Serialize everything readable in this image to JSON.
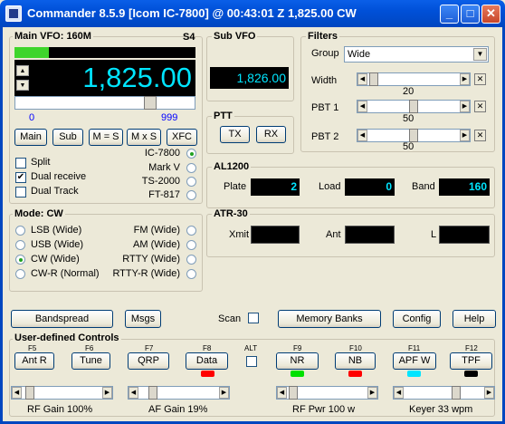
{
  "window": {
    "title": "Commander 8.5.9 [Icom IC-7800] @ 00:43:01 Z  1,825.00 CW"
  },
  "main_vfo": {
    "title": "Main VFO: 160M",
    "s_meter": "S4",
    "frequency": "1,825.00",
    "slider_min": "0",
    "slider_max": "999",
    "buttons": [
      "Main",
      "Sub",
      "M = S",
      "M x S",
      "XFC"
    ],
    "checks": [
      {
        "label": "Split",
        "checked": false
      },
      {
        "label": "Dual receive",
        "checked": true
      },
      {
        "label": "Dual Track",
        "checked": false
      }
    ],
    "radios": [
      {
        "label": "IC-7800",
        "on": true
      },
      {
        "label": "Mark V",
        "on": false
      },
      {
        "label": "TS-2000",
        "on": false
      },
      {
        "label": "FT-817",
        "on": false
      }
    ]
  },
  "sub_vfo": {
    "title": "Sub VFO",
    "frequency": "1,826.00"
  },
  "ptt": {
    "title": "PTT",
    "tx": "TX",
    "rx": "RX"
  },
  "filters": {
    "title": "Filters",
    "group_label": "Group",
    "group_value": "Wide",
    "rows": [
      {
        "label": "Width",
        "value": "20"
      },
      {
        "label": "PBT 1",
        "value": "50"
      },
      {
        "label": "PBT 2",
        "value": "50"
      }
    ]
  },
  "mode": {
    "title": "Mode: CW",
    "left": [
      {
        "label": "LSB (Wide)",
        "on": false
      },
      {
        "label": "USB (Wide)",
        "on": false
      },
      {
        "label": "CW (Wide)",
        "on": true
      },
      {
        "label": "CW-R (Normal)",
        "on": false
      }
    ],
    "right": [
      {
        "label": "FM (Wide)",
        "on": false
      },
      {
        "label": "AM (Wide)",
        "on": false
      },
      {
        "label": "RTTY (Wide)",
        "on": false
      },
      {
        "label": "RTTY-R (Wide)",
        "on": false
      }
    ]
  },
  "al1200": {
    "title": "AL1200",
    "plate_label": "Plate",
    "plate": "2",
    "load_label": "Load",
    "load": "0",
    "band_label": "Band",
    "band": "160"
  },
  "atr30": {
    "title": "ATR-30",
    "xmit_label": "Xmit",
    "ant_label": "Ant",
    "l_label": "L"
  },
  "toolbar": {
    "bandspread": "Bandspread",
    "msgs": "Msgs",
    "scan": "Scan",
    "memory_banks": "Memory Banks",
    "config": "Config",
    "help": "Help"
  },
  "udc": {
    "title": "User-defined Controls",
    "alt": "ALT",
    "buttons": [
      {
        "fkey": "F5",
        "label": "Ant R"
      },
      {
        "fkey": "F6",
        "label": "Tune"
      },
      {
        "fkey": "F7",
        "label": "QRP"
      },
      {
        "fkey": "F8",
        "label": "Data"
      },
      {
        "fkey": "F9",
        "label": "NR"
      },
      {
        "fkey": "F10",
        "label": "NB"
      },
      {
        "fkey": "F11",
        "label": "APF W"
      },
      {
        "fkey": "F12",
        "label": "TPF"
      }
    ],
    "leds": {
      "data": "#ff0000",
      "nr": "#00e000",
      "nb": "#ff0000",
      "apf": "#00e5ff",
      "tpf": "#000000"
    },
    "sliders": [
      {
        "label": "RF Gain 100%"
      },
      {
        "label": "AF Gain 19%"
      },
      {
        "label": "RF Pwr 100 w"
      },
      {
        "label": "Keyer 33 wpm"
      }
    ]
  }
}
